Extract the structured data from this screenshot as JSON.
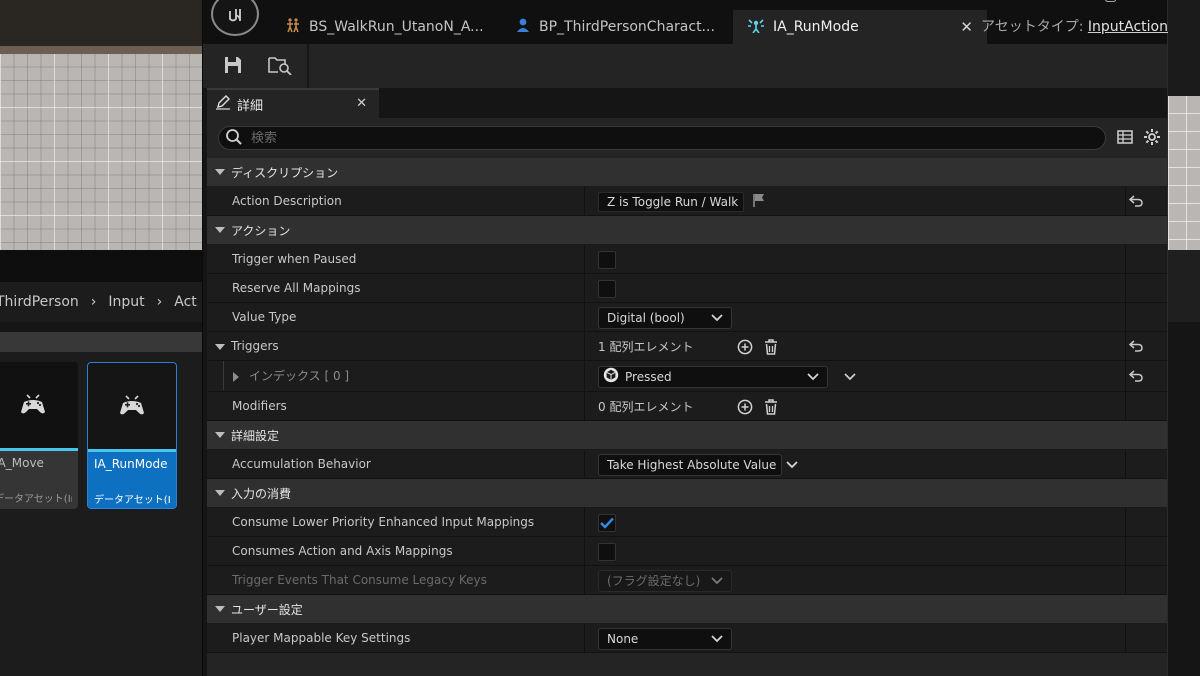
{
  "background": {
    "breadcrumb": [
      "ThirdPerson",
      "Input",
      "Act"
    ],
    "assets": [
      {
        "name": "IA_Move",
        "type": "データアセット(In..."
      },
      {
        "name": "IA_RunMode",
        "type": "データアセット(I..."
      }
    ]
  },
  "window": {
    "tabs": [
      {
        "label": "BS_WalkRun_UtanoN_A...",
        "icon": "blendspace-icon"
      },
      {
        "label": "BP_ThirdPersonCharact...",
        "icon": "character-icon"
      },
      {
        "label": "IA_RunMode",
        "icon": "input-action-icon",
        "active": true
      }
    ],
    "close_glyph": "✕",
    "asset_type_label": "アセットタイプ:",
    "asset_type_value": "InputAction"
  },
  "toolbar": {
    "save": "save-icon",
    "browse": "browse-icon"
  },
  "details": {
    "tab_label": "詳細",
    "search_placeholder": "検索",
    "categories": {
      "description": "ディスクリプション",
      "action": "アクション",
      "advanced": "詳細設定",
      "input_consumption": "入力の消費",
      "user_settings": "ユーザー設定"
    },
    "props": {
      "action_description": {
        "label": "Action Description",
        "value": "Z is Toggle Run / Walk"
      },
      "trigger_when_paused": {
        "label": "Trigger when Paused",
        "checked": false
      },
      "reserve_all_mappings": {
        "label": "Reserve All Mappings",
        "checked": false
      },
      "value_type": {
        "label": "Value Type",
        "value": "Digital (bool)"
      },
      "triggers": {
        "label": "Triggers",
        "count": "1 配列エレメント"
      },
      "trigger_index": {
        "label": "インデックス [ 0 ]",
        "value": "Pressed"
      },
      "modifiers": {
        "label": "Modifiers",
        "count": "0 配列エレメント"
      },
      "accumulation_behavior": {
        "label": "Accumulation Behavior",
        "value": "Take Highest Absolute Value"
      },
      "consume_lower_priority": {
        "label": "Consume Lower Priority Enhanced Input Mappings",
        "checked": true
      },
      "consumes_action_axis": {
        "label": "Consumes Action and Axis Mappings",
        "checked": false
      },
      "trigger_events_legacy": {
        "label": "Trigger Events That Consume Legacy Keys",
        "value": "(フラグ設定なし)"
      },
      "player_mappable": {
        "label": "Player Mappable Key Settings",
        "value": "None"
      }
    }
  },
  "colors": {
    "accent": "#0e70c0",
    "checkbox": "#2f8ee0",
    "panel": "#242424",
    "row": "#1c1c1c",
    "category": "#303030"
  }
}
